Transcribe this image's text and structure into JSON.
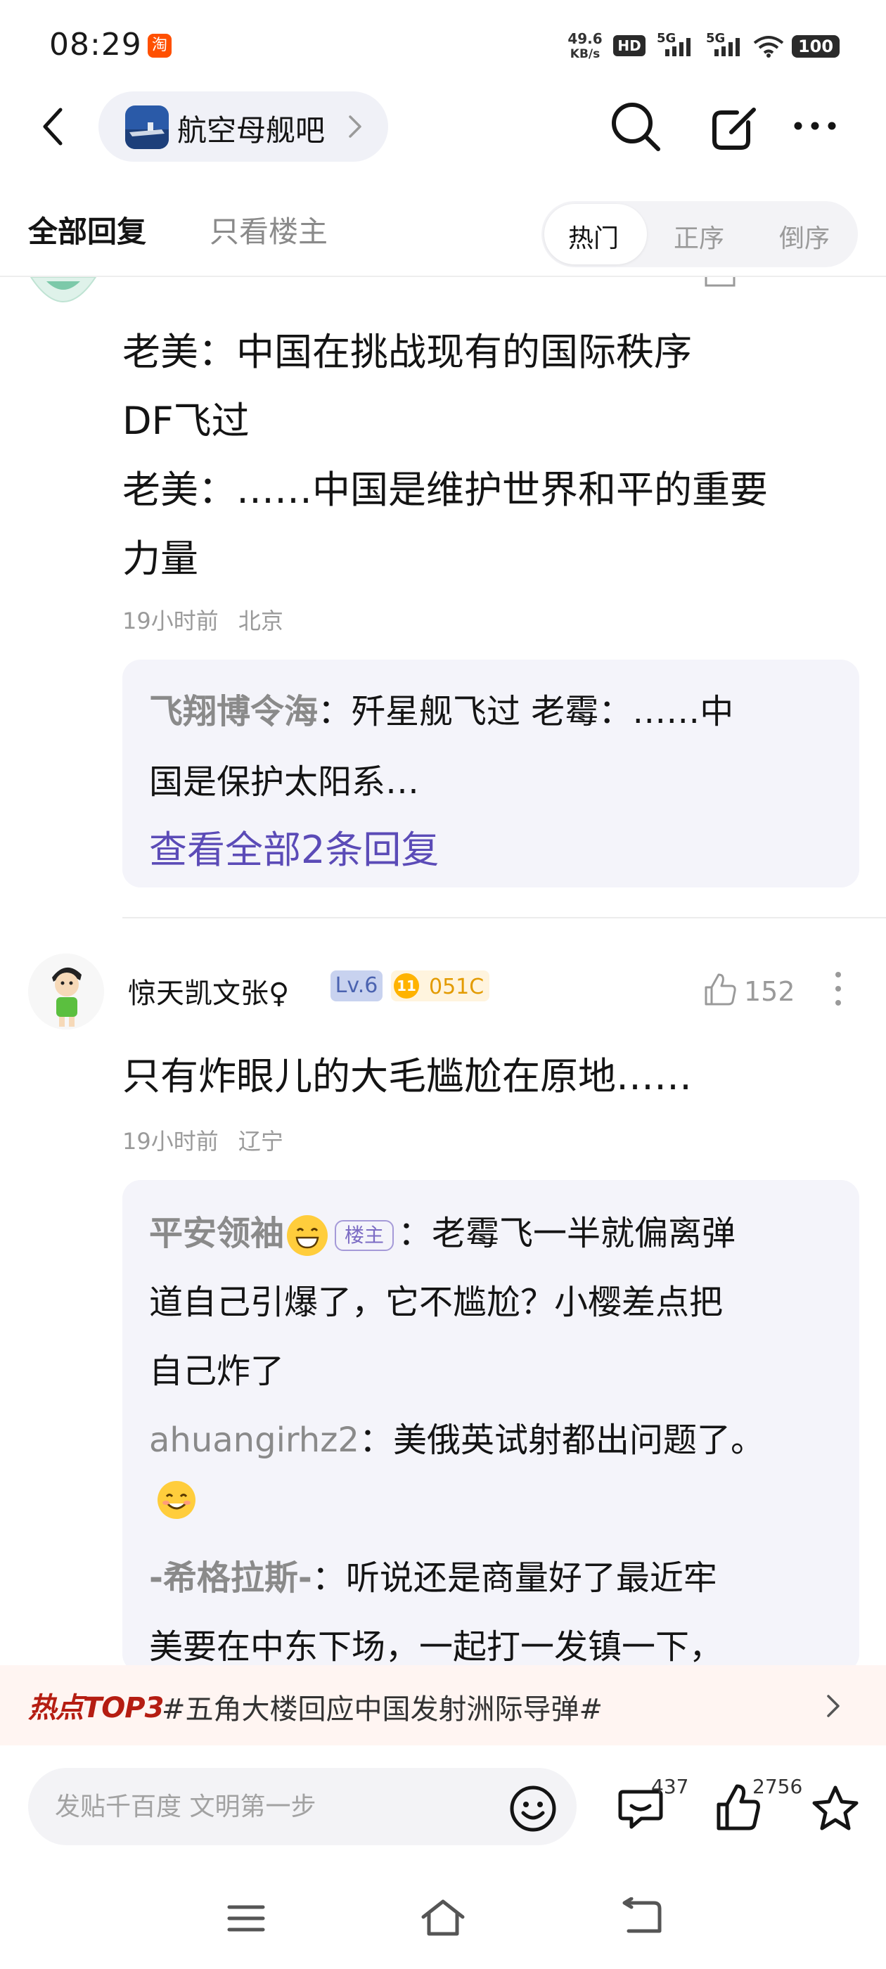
{
  "status_bar": {
    "time": "08:29",
    "taobao_badge": "淘",
    "net_speed_value": "49.6",
    "net_speed_unit": "KB/s",
    "hd_label": "HD",
    "sim1_label": "5G",
    "sim2_label": "5G",
    "battery": "100"
  },
  "header": {
    "forum_name": "航空母舰吧"
  },
  "tabs": {
    "all_replies": "全部回复",
    "op_only": "只看楼主",
    "sort_hot": "热门",
    "sort_asc": "正序",
    "sort_desc": "倒序",
    "active_sort": "热门"
  },
  "post1": {
    "lines": [
      "老美：中国在挑战现有的国际秩序",
      "DF飞过",
      "老美：……中国是维护世界和平的重要",
      "力量"
    ],
    "time": "19小时前",
    "location": "北京",
    "reply_author": "飞翔博令海",
    "reply_text_line1": "：歼星舰飞过 老霉：……中",
    "reply_text_line2": "国是保护太阳系…",
    "view_all": "查看全部2条回复"
  },
  "post2": {
    "username": "惊天凯文张♀",
    "level": "Lv.6",
    "fan_level": "11",
    "fan_code": "051C",
    "likes": "152",
    "text": "只有炸眼儿的大毛尴尬在原地……",
    "time": "19小时前",
    "location": "辽宁",
    "replies": {
      "r1_author": "平安领袖",
      "r1_owner_tag": "楼主",
      "r1_line1": "：老霉飞一半就偏离弹",
      "r1_line2": "道自己引爆了，它不尴尬？小樱差点把",
      "r1_line3": "自己炸了",
      "r2_author": "ahuangirhz2",
      "r2_line1": "：美俄英试射都出问题了。",
      "r3_author": "-希格拉斯-",
      "r3_line1": "：听说还是商量好了最近牢",
      "r3_line2": "美要在中东下场，一起打一发镇一下，"
    }
  },
  "hot_topic": {
    "tag": "热点TOP3",
    "title": "#五角大楼回应中国发射洲际导弹#"
  },
  "bottom_bar": {
    "input_placeholder": "发贴千百度 文明第一步",
    "comments_count": "437",
    "likes_count": "2756"
  },
  "colors": {
    "accent_purple": "#5b4bb7",
    "hot_red": "#b51d12",
    "reply_bg": "#f4f4fa"
  }
}
